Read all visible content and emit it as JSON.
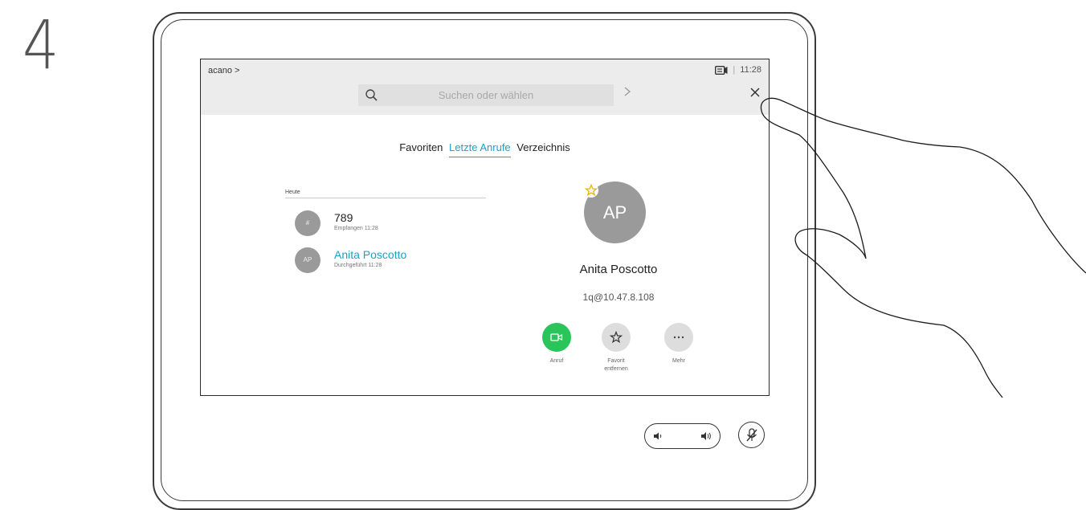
{
  "step": "4",
  "screen": {
    "breadcrumb": "acano >",
    "status": {
      "camera_icon": "screen-share-icon",
      "separator": "|",
      "time": "11:28"
    },
    "search": {
      "placeholder": "Suchen oder wählen"
    },
    "tabs": [
      {
        "label": "Favoriten",
        "active": false
      },
      {
        "label": "Letzte Anrufe",
        "active": true
      },
      {
        "label": "Verzeichnis",
        "active": false
      }
    ],
    "recent": {
      "section_label": "Heute",
      "entries": [
        {
          "avatar": "#",
          "name": "789",
          "detail": "Empfangen 11:28"
        },
        {
          "avatar": "AP",
          "name": "Anita Poscotto",
          "detail": "Durchgeführt 11:28"
        }
      ]
    },
    "contact": {
      "initials": "AP",
      "name": "Anita Poscotto",
      "address": "1q@10.47.8.108",
      "favorite": true
    },
    "actions": [
      {
        "label": "Anruf",
        "icon": "video-call-icon",
        "color": "#2ac55a"
      },
      {
        "label": "Favorit entfernen",
        "icon": "star-icon",
        "color": "#dddddd"
      },
      {
        "label": "Mehr",
        "icon": "more-icon",
        "color": "#dddddd"
      }
    ]
  },
  "colors": {
    "accent": "#1aa3c8",
    "call_green": "#2ac55a",
    "avatar_gray": "#9a9a9a"
  }
}
